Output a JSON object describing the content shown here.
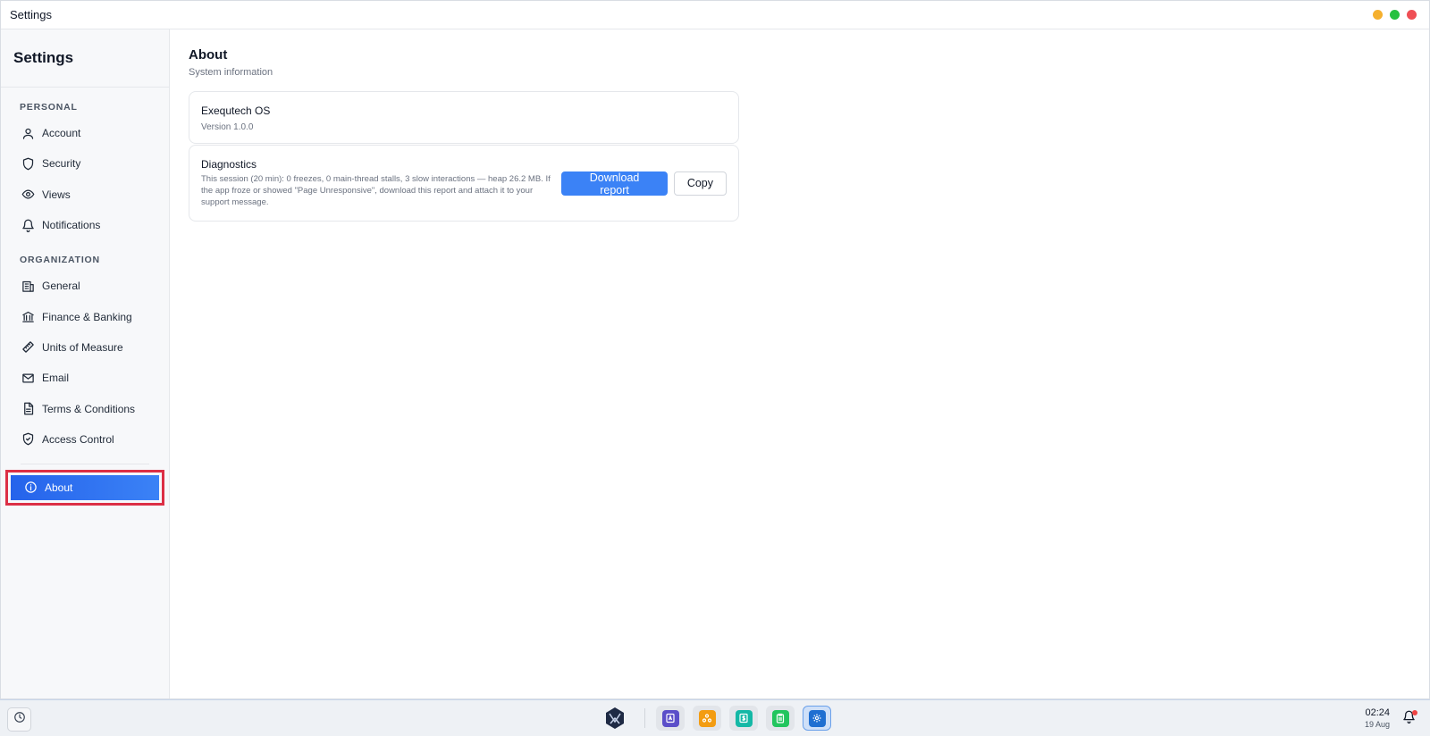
{
  "window": {
    "title": "Settings",
    "controls": [
      {
        "name": "minimize",
        "color": "#f5b02e"
      },
      {
        "name": "maximize",
        "color": "#27c140"
      },
      {
        "name": "close",
        "color": "#ef4f55"
      }
    ]
  },
  "sidebar": {
    "title": "Settings",
    "sections": [
      {
        "label": "PERSONAL",
        "items": [
          {
            "label": "Account",
            "icon": "user-icon"
          },
          {
            "label": "Security",
            "icon": "shield-icon"
          },
          {
            "label": "Views",
            "icon": "eye-icon"
          },
          {
            "label": "Notifications",
            "icon": "bell-icon"
          }
        ]
      },
      {
        "label": "ORGANIZATION",
        "items": [
          {
            "label": "General",
            "icon": "building-icon"
          },
          {
            "label": "Finance & Banking",
            "icon": "bank-icon"
          },
          {
            "label": "Units of Measure",
            "icon": "ruler-icon"
          },
          {
            "label": "Email",
            "icon": "mail-icon"
          },
          {
            "label": "Terms & Conditions",
            "icon": "document-icon"
          },
          {
            "label": "Access Control",
            "icon": "shield-check-icon"
          }
        ]
      }
    ],
    "active_item": {
      "label": "About",
      "icon": "info-icon"
    }
  },
  "main": {
    "title": "About",
    "subtitle": "System information",
    "os_card": {
      "name": "Exequtech OS",
      "version": "Version 1.0.0"
    },
    "diagnostics_card": {
      "title": "Diagnostics",
      "description": "This session (20 min): 0 freezes, 0 main-thread stalls, 3 slow interactions — heap 26.2 MB. If the app froze or showed \"Page Unresponsive\", download this report and attach it to your support message.",
      "download_label": "Download report",
      "copy_label": "Copy"
    }
  },
  "taskbar": {
    "history_icon": "clock-icon",
    "apps": [
      {
        "name": "contacts-app-icon",
        "color": "#5b4fc9"
      },
      {
        "name": "network-app-icon",
        "color": "#f39c12"
      },
      {
        "name": "dollar-app-icon",
        "color": "#14b8a6"
      },
      {
        "name": "clipboard-app-icon",
        "color": "#22c55e"
      },
      {
        "name": "settings-app-icon",
        "color": "#1f6fd1",
        "active": true
      }
    ],
    "time": "02:24",
    "date": "19 Aug"
  },
  "accent_color": "#3b82f6"
}
